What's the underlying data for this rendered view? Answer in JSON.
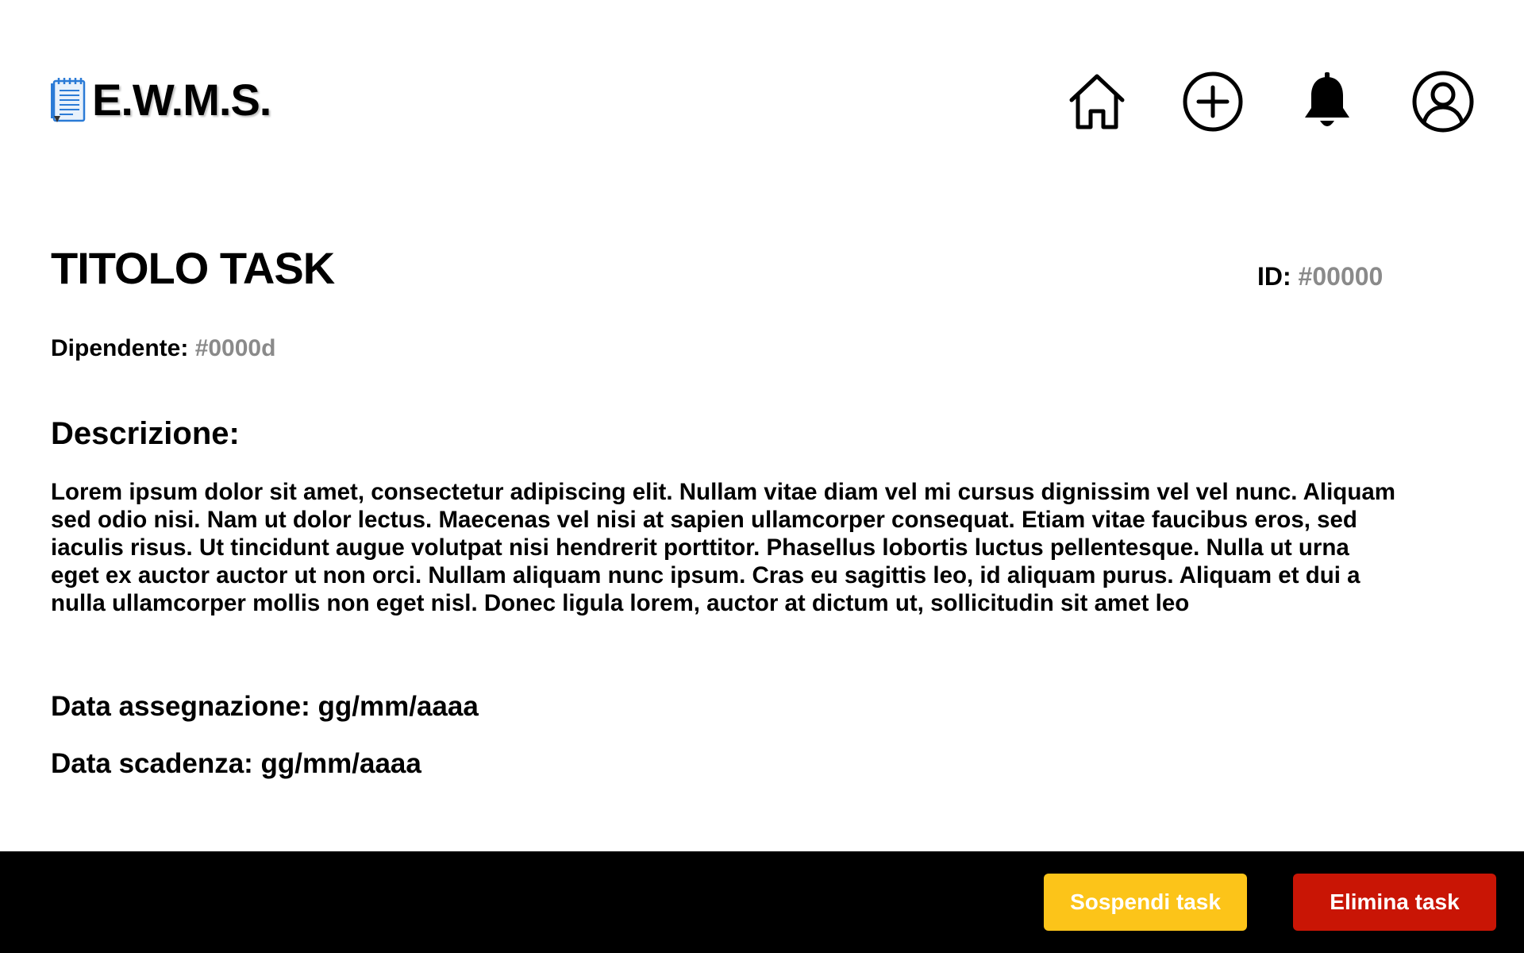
{
  "header": {
    "app_name": "E.W.M.S.",
    "logo_icon": "notepad-icon",
    "nav": [
      {
        "icon": "home-icon"
      },
      {
        "icon": "add-circle-icon"
      },
      {
        "icon": "bell-icon"
      },
      {
        "icon": "user-account-icon"
      }
    ]
  },
  "task": {
    "title": "TITOLO TASK",
    "id_label": "ID:",
    "id_value": "#00000",
    "employee_label": "Dipendente:",
    "employee_value": "#0000d",
    "description_heading": "Descrizione:",
    "description": "Lorem ipsum dolor sit amet, consectetur adipiscing elit. Nullam vitae diam vel mi cursus dignissim vel vel nunc. Aliquam sed odio nisi. Nam ut dolor lectus. Maecenas vel nisi at sapien ullamcorper consequat. Etiam vitae faucibus eros, sed iaculis risus. Ut tincidunt augue volutpat nisi hendrerit porttitor. Phasellus lobortis luctus pellentesque. Nulla ut urna eget ex auctor auctor ut non orci. Nullam aliquam nunc ipsum. Cras eu sagittis leo, id aliquam purus. Aliquam et dui a nulla ullamcorper mollis non eget nisl. Donec ligula lorem, auctor at dictum ut, sollicitudin sit amet leo",
    "assigned_date": "Data assegnazione: gg/mm/aaaa",
    "due_date": "Data scadenza: gg/mm/aaaa"
  },
  "footer": {
    "suspend_label": "Sospendi task",
    "delete_label": "Elimina task"
  },
  "colors": {
    "footer_bg": "#000000",
    "suspend_button": "#fcc419",
    "delete_button": "#c91505",
    "muted_value": "#8a8a8a"
  }
}
